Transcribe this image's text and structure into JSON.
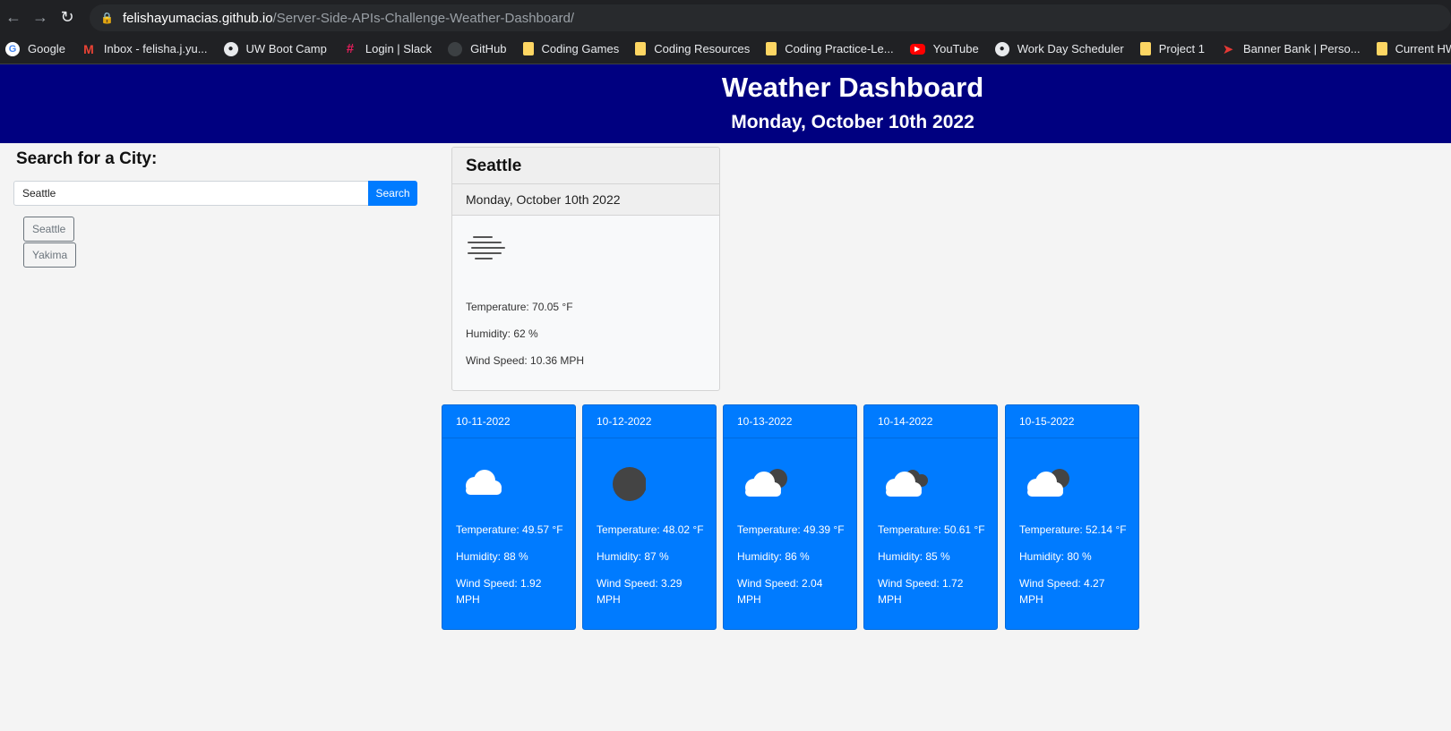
{
  "browser": {
    "url_host": "felishayumacias.github.io",
    "url_path": "/Server-Side-APIs-Challenge-Weather-Dashboard/",
    "bookmarks": [
      {
        "label": "Google",
        "icon": "google-icon"
      },
      {
        "label": "Inbox - felisha.j.yu...",
        "icon": "gmail-icon"
      },
      {
        "label": "UW Boot Camp",
        "icon": "globe-icon"
      },
      {
        "label": "Login | Slack",
        "icon": "slack-icon"
      },
      {
        "label": "GitHub",
        "icon": "github-icon"
      },
      {
        "label": "Coding Games",
        "icon": "folder-icon"
      },
      {
        "label": "Coding Resources",
        "icon": "folder-icon"
      },
      {
        "label": "Coding Practice-Le...",
        "icon": "folder-icon"
      },
      {
        "label": "YouTube",
        "icon": "youtube-icon"
      },
      {
        "label": "Work Day Scheduler",
        "icon": "globe-icon"
      },
      {
        "label": "Project 1",
        "icon": "folder-icon"
      },
      {
        "label": "Banner Bank | Perso...",
        "icon": "bank-icon"
      },
      {
        "label": "Current HW Resour...",
        "icon": "folder-icon"
      }
    ]
  },
  "header": {
    "title": "Weather Dashboard",
    "date": "Monday, October 10th 2022"
  },
  "search": {
    "title": "Search for a City:",
    "value": "Seattle",
    "button_label": "Search",
    "history": [
      "Seattle",
      "Yakima"
    ]
  },
  "current": {
    "city": "Seattle",
    "date": "Monday, October 10th 2022",
    "icon": "mist-icon",
    "temperature": "Temperature: 70.05 °F",
    "humidity": "Humidity: 62 %",
    "wind": "Wind Speed: 10.36 MPH"
  },
  "forecast": [
    {
      "date": "10-11-2022",
      "icon": "cloud-icon",
      "temperature": "Temperature: 49.57 °F",
      "humidity": "Humidity: 88 %",
      "wind": "Wind Speed: 1.92 MPH"
    },
    {
      "date": "10-12-2022",
      "icon": "dark-circle-icon",
      "temperature": "Temperature: 48.02 °F",
      "humidity": "Humidity: 87 %",
      "wind": "Wind Speed: 3.29 MPH"
    },
    {
      "date": "10-13-2022",
      "icon": "partly-cloudy-icon",
      "temperature": "Temperature: 49.39 °F",
      "humidity": "Humidity: 86 %",
      "wind": "Wind Speed: 2.04 MPH"
    },
    {
      "date": "10-14-2022",
      "icon": "broken-clouds-icon",
      "temperature": "Temperature: 50.61 °F",
      "humidity": "Humidity: 85 %",
      "wind": "Wind Speed: 1.72 MPH"
    },
    {
      "date": "10-15-2022",
      "icon": "partly-cloudy-icon",
      "temperature": "Temperature: 52.14 °F",
      "humidity": "Humidity: 80 %",
      "wind": "Wind Speed: 4.27 MPH"
    }
  ],
  "colors": {
    "header_bg": "#000080",
    "card_bg": "#007bff",
    "button_bg": "#007bff"
  }
}
